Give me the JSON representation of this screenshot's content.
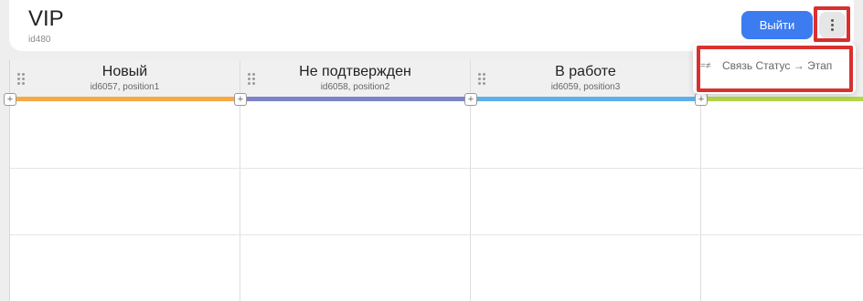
{
  "header": {
    "title": "VIP",
    "subtitle": "id480",
    "exit_label": "Выйти",
    "more_icon": "vertical-dots-icon"
  },
  "columns": [
    {
      "name": "Новый",
      "meta": "id6057, position1",
      "color": "#f5aa46"
    },
    {
      "name": "Не подтвержден",
      "meta": "id6058, position2",
      "color": "#7d82c8"
    },
    {
      "name": "В работе",
      "meta": "id6059, position3",
      "color": "#5db0e8"
    },
    {
      "name": "",
      "meta": "",
      "color": "#b4d84a"
    }
  ],
  "menu": {
    "items": [
      {
        "label": "Связь Статус → Этап",
        "icon": "link-status-icon",
        "icon_glyph": "=≠"
      }
    ]
  },
  "colors": {
    "accent": "#3d7cf0",
    "highlight": "#d93030"
  }
}
